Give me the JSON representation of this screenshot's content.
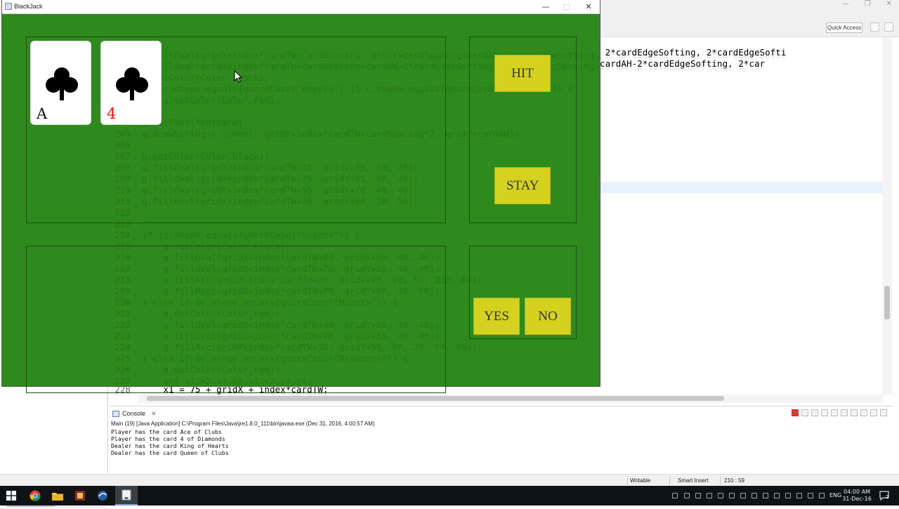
{
  "ide": {
    "quick_access": "Quick Access",
    "code_lines": [
      {
        "num": "198",
        "text": "g.fillOval(gridX+index*cardTW+cardSpacing, gridY+cardSpacing+cardAH-2*cardEdgeSofting, 2*cardEdgeSofting, 2*cardEdgeSofti"
      },
      {
        "num": "199",
        "text": "g.fillOval(gridX+index*cardTW+cardSpacing+cardAW-2*cardEdgeSofting, gridY+cardSpacing+cardAH-2*cardEdgeSofting, 2*car"
      },
      {
        "num": "200",
        "text": "g.setColor(Color.black);"
      },
      {
        "num": "201",
        "text": "if (c.shape.equalsIgnoreCase(\"Hearts\") || c.shape.equalsIgnoreCase(\"Diamonds\")) {"
      },
      {
        "num": "202",
        "text": "    g.setColor(Color.red);"
      },
      {
        "num": "203",
        "text": "}"
      },
      {
        "num": "204",
        "text": "g.setFont(fontCard);"
      },
      {
        "num": "205",
        "text": "g.drawString(c.symbol, gridX+index*cardTW+cardSpacing*2, gridY+cardAH);"
      },
      {
        "num": "206",
        "text": ""
      },
      {
        "num": "207",
        "text": "g.setColor(Color.black);"
      },
      {
        "num": "208",
        "text": "g.fillOval(gridX+index*cardTW+35, gridY+85, 40, 40);"
      },
      {
        "num": "209",
        "text": "g.fillOval(gridX+index*cardTW+75, gridY+85, 40, 40);"
      },
      {
        "num": "210",
        "text": "g.fillOval(gridX+index*cardTW+55, gridY+70, 40, 40);"
      },
      {
        "num": "211",
        "text": "g.fillRect(gridX+index*cardTW+70, gridY+90, 10, 50);"
      },
      {
        "num": "212",
        "text": ""
      },
      {
        "num": "213",
        "text": "/*"
      },
      {
        "num": "214",
        "text": "if (c.shape.equalsIgnoreCase(\"Spades\")) {"
      },
      {
        "num": "215",
        "text": "    g.setColor(Color.black);"
      },
      {
        "num": "216",
        "text": "    g.fillOval(gridX+index*cardTW+40, gridY+85, 40, 40);"
      },
      {
        "num": "217",
        "text": "    g.fillOval(gridX+index*cardTW+70, gridY+85, 40, 40);"
      },
      {
        "num": "218",
        "text": "    g.fillArc(gridX+index*cardTW+30, gridY+70, 90, 50, 230, 80);"
      },
      {
        "num": "219",
        "text": "    g.fillRect(gridX+index*cardTW+70, gridY+90, 10, 50);"
      },
      {
        "num": "220",
        "text": "} else if (c.shape.equalsIgnoreCase(\"Hearts\")) {"
      },
      {
        "num": "221",
        "text": "    g.setColor(Color.red);"
      },
      {
        "num": "222",
        "text": "    g.fillOval(gridX+index*cardTW+40, gridY+85, 40, 40);"
      },
      {
        "num": "223",
        "text": "    g.fillOval(gridX+index*cardTW+70, gridY+85, 40, 40);"
      },
      {
        "num": "224",
        "text": "    g.fillArc(gridX+index*cardTW+30, gridY+96, 90, 70, 50, 80);"
      },
      {
        "num": "225",
        "text": "} else if (c.shape.equalsIgnoreCase(\"Diamonds\")) {"
      },
      {
        "num": "226",
        "text": "    g.setColor(Color.red);"
      },
      {
        "num": "227",
        "text": "    int x1,x2,x3,x4,y1,y2,y3,y4;"
      },
      {
        "num": "228",
        "text": "    x1 = 75 + gridX + index*cardTW;"
      }
    ],
    "console": {
      "tab_label": "Console",
      "header": "Main (19) [Java Application] C:\\Program Files\\Java\\jre1.8.0_111\\bin\\javaw.exe (Dec 31, 2016, 4:00:57 AM)",
      "lines": [
        "Player has the card Ace of Clubs",
        "Player has the card 4 of Diamonds",
        "Dealer has the card King of Hearts",
        "Dealer has the card Queen of Clubs"
      ]
    },
    "status": {
      "writable": "Writable",
      "insert_mode": "Smart Insert",
      "position": "210 : 59"
    }
  },
  "taskbar": {
    "language": "ENG",
    "time": "04:00 AM",
    "date": "31-Dec-16",
    "notification_count": "2"
  },
  "blackjack": {
    "title": "BlackJack",
    "colors": {
      "table": "#2e8a1c",
      "button": "#d4d21f",
      "panel_border": "#1c4f12",
      "red_rank": "#e01010"
    },
    "player_cards": [
      {
        "rank": "A",
        "suit": "club-icon",
        "rank_color": "#111111"
      },
      {
        "rank": "4",
        "suit": "club-icon",
        "rank_color": "#e01010"
      }
    ],
    "buttons": {
      "hit": "HIT",
      "stay": "STAY",
      "yes": "YES",
      "no": "NO"
    }
  }
}
